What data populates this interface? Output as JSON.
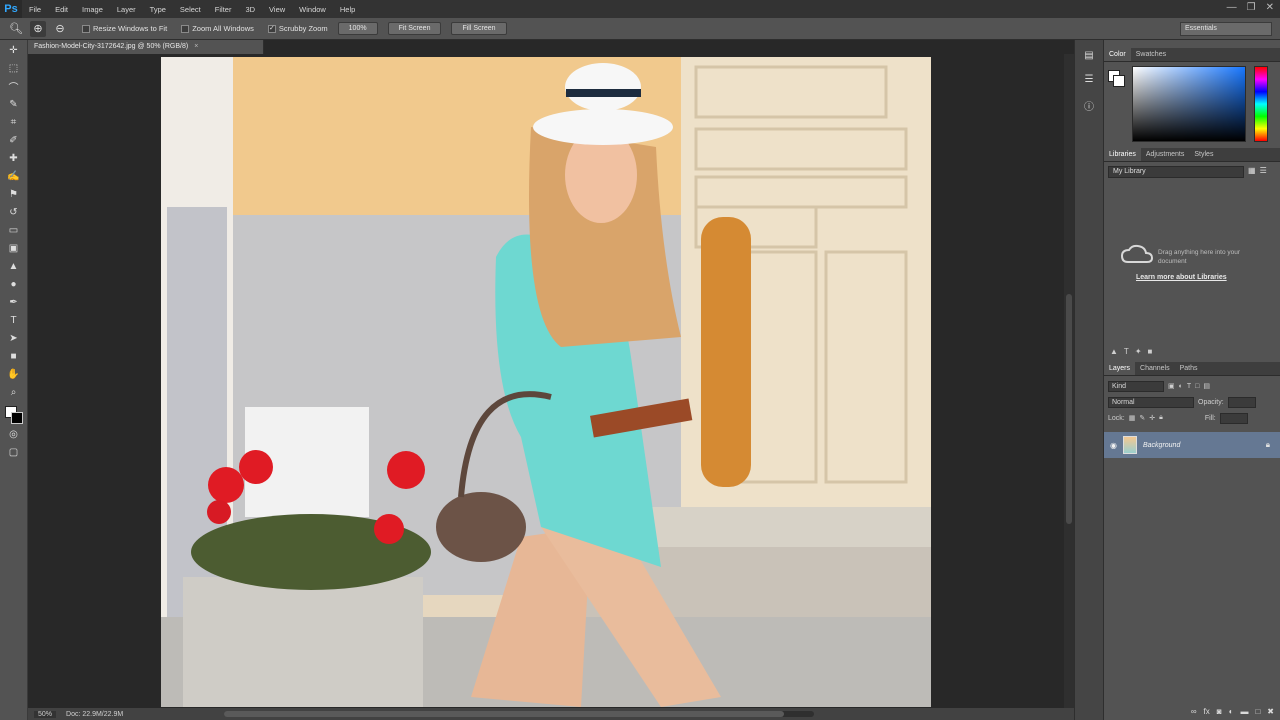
{
  "app": {
    "logo": "Ps",
    "menu": [
      "File",
      "Edit",
      "Image",
      "Layer",
      "Type",
      "Select",
      "Filter",
      "3D",
      "View",
      "Window",
      "Help"
    ],
    "window_controls": [
      "—",
      "❐",
      "✕"
    ]
  },
  "options_bar": {
    "tool_icons": [
      "zoom-icon",
      "zoom-in-icon",
      "zoom-out-icon"
    ],
    "checkbox_resize": "Resize Windows to Fit",
    "checkbox_zoom_all": "Zoom All Windows",
    "checkbox_scrubby": "Scrubby Zoom",
    "btn_100": "100%",
    "btn_fit": "Fit Screen",
    "btn_fill": "Fill Screen",
    "workspace": "Essentials"
  },
  "document": {
    "tab_title": "Fashion-Model-City-3172642.jpg @ 50% (RGB/8)",
    "tab_close": "×"
  },
  "status": {
    "zoom": "50%",
    "doc_info": "Doc: 22.9M/22.9M"
  },
  "panels": {
    "color_tabs": [
      "Color",
      "Swatches"
    ],
    "library_tabs": [
      "Libraries",
      "Adjustments",
      "Styles"
    ],
    "library_select": "My Library",
    "library_drag_text": "Drag anything here into your document",
    "library_learn": "Learn more about Libraries",
    "layer_tabs": [
      "Layers",
      "Channels",
      "Paths"
    ],
    "kind_label": "Kind",
    "blend_mode": "Normal",
    "opacity_label": "Opacity:",
    "lock_label": "Lock:",
    "fill_label": "Fill:",
    "layer_name": "Background"
  },
  "colors": {
    "accent": "#31a8ff",
    "selected_layer": "#657893",
    "panel_bg": "#535353",
    "canvas_bg": "#282828"
  }
}
